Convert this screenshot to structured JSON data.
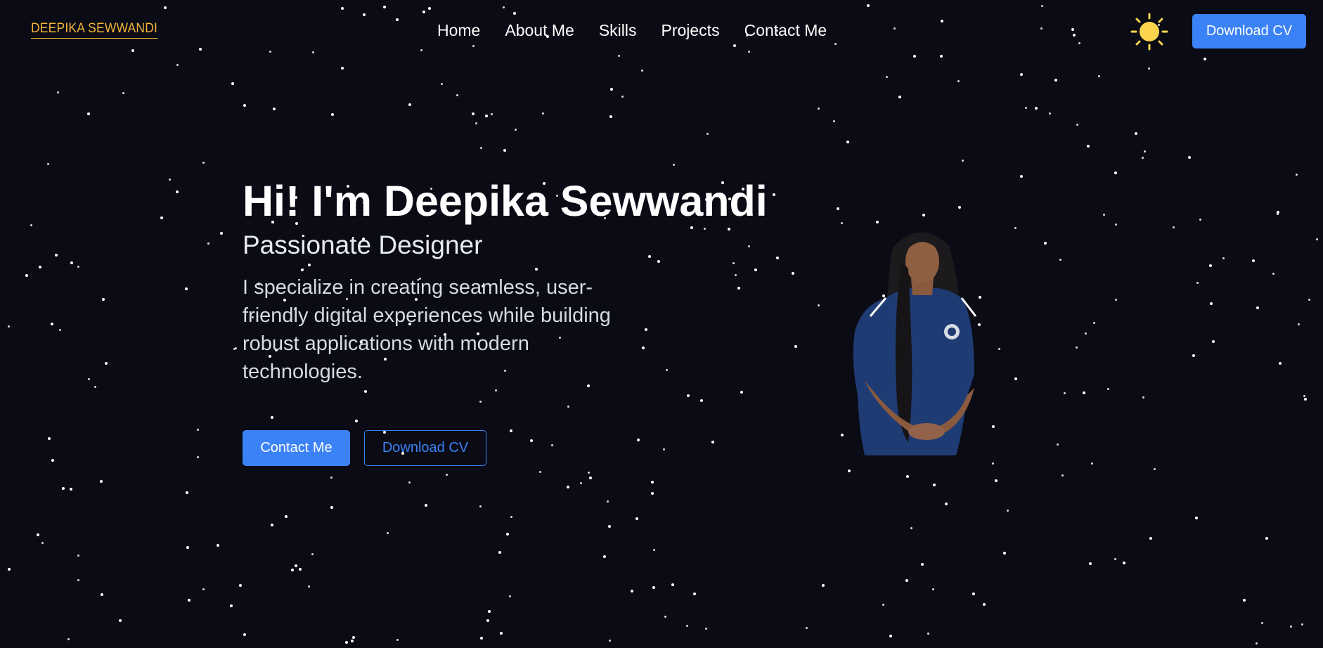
{
  "brand": {
    "logo_text": "DEEPIKA SEWWANDI",
    "logo_color": "#f2b53a"
  },
  "nav": {
    "links": [
      {
        "label": "Home"
      },
      {
        "label": "About Me"
      },
      {
        "label": "Skills"
      },
      {
        "label": "Projects"
      },
      {
        "label": "Contact Me"
      }
    ],
    "theme_toggle_icon": "sun-icon",
    "cv_button_label": "Download CV"
  },
  "hero": {
    "title": "Hi! I'm Deepika Sewwandi",
    "subtitle": "Passionate Designer",
    "description": "I specialize in creating seamless, user-friendly digital experiences while building robust applications with modern technologies.",
    "contact_button_label": "Contact Me",
    "download_button_label": "Download CV",
    "portrait_icon": "profile-photo"
  },
  "theme": {
    "background": "#0a0b14",
    "accent": "#3b82f6",
    "sun_color": "#fcd34d"
  }
}
